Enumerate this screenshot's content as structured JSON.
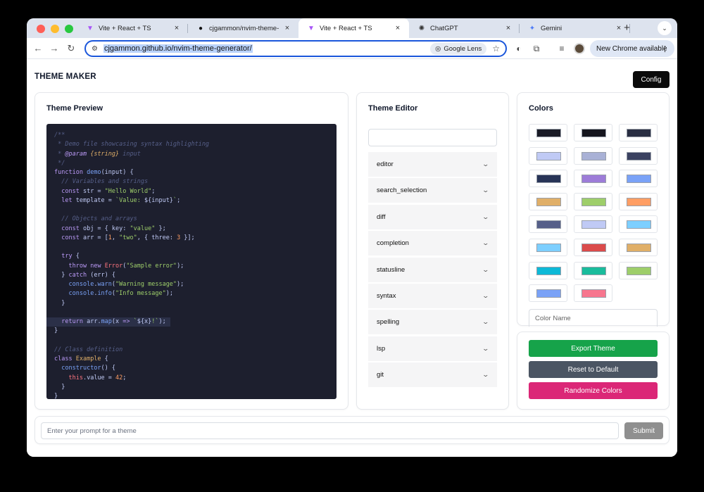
{
  "browser": {
    "tabs": [
      {
        "label": "Vite + React + TS",
        "icon": "vite-icon",
        "active": false
      },
      {
        "label": "cjgammon/nvim-theme-gen",
        "icon": "github-icon",
        "active": false
      },
      {
        "label": "Vite + React + TS",
        "icon": "vite-icon",
        "active": true
      },
      {
        "label": "ChatGPT",
        "icon": "chatgpt-icon",
        "active": false
      },
      {
        "label": "Gemini",
        "icon": "gemini-icon",
        "active": false
      }
    ],
    "url": "cjgammon.github.io/nvim-theme-generator/",
    "google_lens": "Google Lens",
    "update_button": "New Chrome available"
  },
  "app": {
    "title": "THEME MAKER",
    "config_button": "Config"
  },
  "preview": {
    "title": "Theme Preview"
  },
  "editor": {
    "title": "Theme Editor",
    "search_value": "",
    "sections": [
      "editor",
      "search_selection",
      "diff",
      "completion",
      "statusline",
      "syntax",
      "spelling",
      "lsp",
      "git"
    ]
  },
  "colors": {
    "title": "Colors",
    "swatches": [
      "#1a1b26",
      "#16161e",
      "#292e42",
      "#c0caf5",
      "#a9b1d6",
      "#3b4261",
      "#283457",
      "#9d7cd8",
      "#7aa2f7",
      "#e0af68",
      "#9ece6a",
      "#ff9e64",
      "#565f89",
      "#c0caf5",
      "#7dcfff",
      "#7dcfff",
      "#db4b4b",
      "#e0af68",
      "#0db9d7",
      "#1abc9c",
      "#9ece6a",
      "#7aa2f7",
      "#f7768e"
    ],
    "color_name_placeholder": "Color Name"
  },
  "actions": {
    "export": "Export Theme",
    "reset": "Reset to Default",
    "randomize": "Randomize Colors",
    "export_color": "#16a34a",
    "reset_color": "#4b5563",
    "randomize_color": "#db2777"
  },
  "prompt": {
    "placeholder": "Enter your prompt for a theme",
    "submit": "Submit"
  }
}
